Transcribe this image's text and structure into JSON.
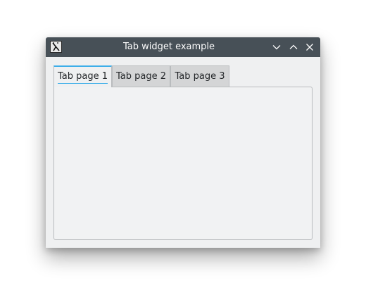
{
  "window": {
    "title": "Tab widget example",
    "app_icon": "x-letter-app-icon",
    "controls": {
      "minimize_icon": "chevron-down-icon",
      "maximize_icon": "chevron-up-icon",
      "close_icon": "close-icon"
    }
  },
  "tabs": [
    {
      "label": "Tab page 1",
      "active": true
    },
    {
      "label": "Tab page 2",
      "active": false
    },
    {
      "label": "Tab page 3",
      "active": false
    }
  ],
  "colors": {
    "titlebar": "#475057",
    "accent": "#3daee9",
    "window_bg": "#eff0f1",
    "inactive_tab": "#d4d5d6"
  }
}
